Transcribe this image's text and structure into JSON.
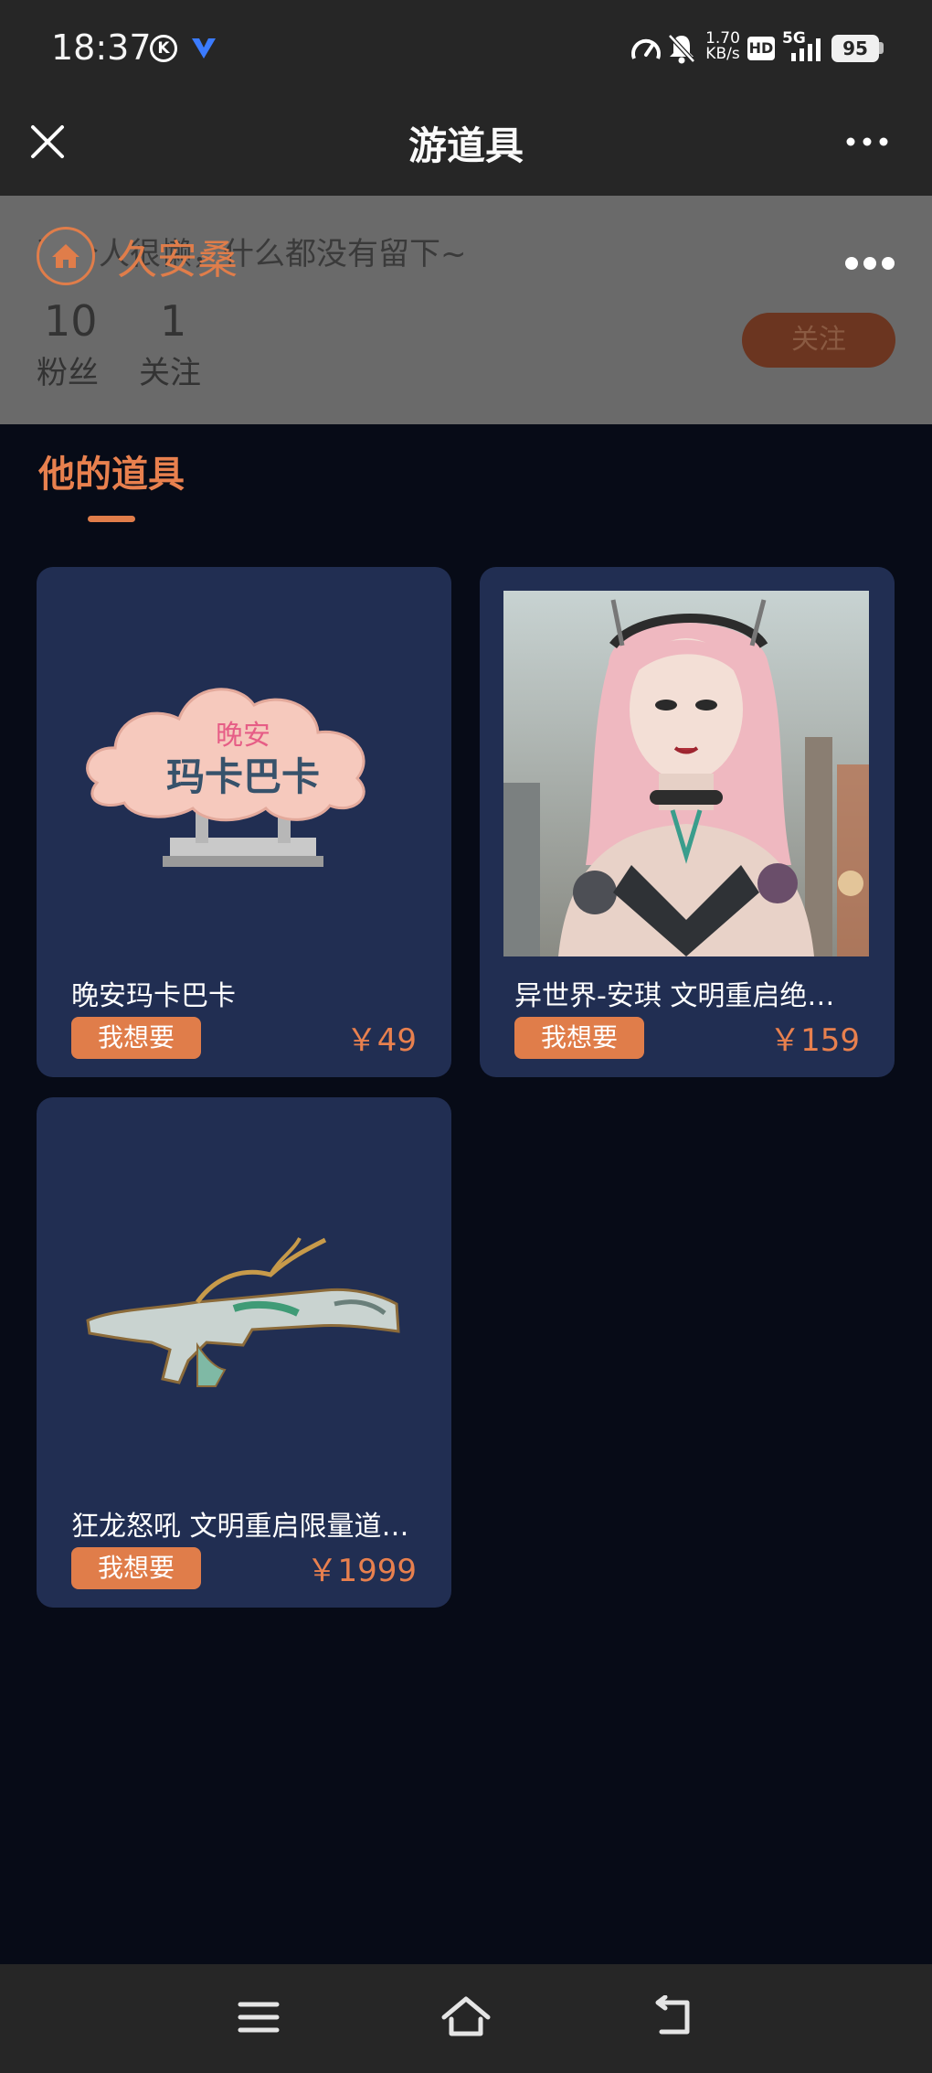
{
  "status_bar": {
    "time": "18:37",
    "k_badge": "K",
    "network_speed_value": "1.70",
    "network_speed_unit": "KB/s",
    "hd_label": "HD",
    "network_type": "5G",
    "battery": "95"
  },
  "nav": {
    "title": "游道具"
  },
  "profile": {
    "signature": "这个人很懒，什么都没有留下~",
    "username": "久安桑",
    "fans_count": "10",
    "fans_label": "粉丝",
    "following_count": "1",
    "following_label": "关注",
    "follow_button": "关注"
  },
  "section": {
    "title": "他的道具"
  },
  "items": [
    {
      "title": "晚安玛卡巴卡",
      "button": "我想要",
      "price": "￥49",
      "image_text_top": "晚安",
      "image_text_bottom": "玛卡巴卡"
    },
    {
      "title": "异世界-安琪 文明重启绝…",
      "button": "我想要",
      "price": "￥159"
    },
    {
      "title": "狂龙怒吼 文明重启限量道…",
      "button": "我想要",
      "price": "￥1999"
    }
  ],
  "colors": {
    "accent": "#e07d4a",
    "card_bg": "#212e52",
    "page_bg": "#070b17",
    "bar_bg": "#262626"
  }
}
